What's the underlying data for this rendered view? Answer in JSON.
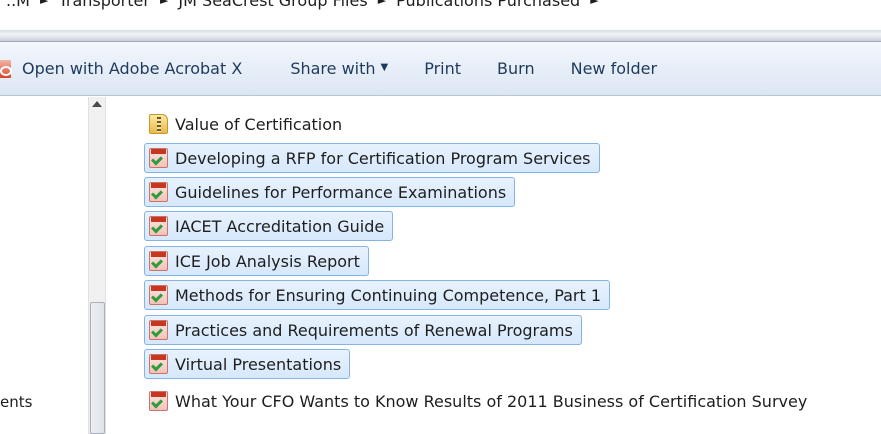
{
  "breadcrumb": {
    "items": [
      "..M",
      "Transporter",
      "JM SeaCrest Group Files",
      "Publications Purchased"
    ]
  },
  "toolbar": {
    "open_with": "Open with Adobe Acrobat X",
    "share_with": "Share with",
    "print": "Print",
    "burn": "Burn",
    "new_folder": "New folder"
  },
  "nav": {
    "partial_item": "ents"
  },
  "files": [
    {
      "name": "Value of Certification",
      "icon": "zip-folder-icon",
      "selected": false
    },
    {
      "name": "Developing a RFP for Certification Program Services",
      "icon": "pdf-icon",
      "selected": true
    },
    {
      "name": "Guidelines for Performance Examinations",
      "icon": "pdf-icon",
      "selected": true
    },
    {
      "name": "IACET Accreditation Guide",
      "icon": "pdf-icon",
      "selected": true
    },
    {
      "name": "ICE Job Analysis Report",
      "icon": "pdf-icon",
      "selected": true
    },
    {
      "name": "Methods for Ensuring Continuing Competence, Part 1",
      "icon": "pdf-icon",
      "selected": true
    },
    {
      "name": "Practices and Requirements of Renewal Programs",
      "icon": "pdf-icon",
      "selected": true
    },
    {
      "name": "Virtual Presentations",
      "icon": "pdf-icon",
      "selected": true
    },
    {
      "name": "What Your CFO Wants to Know Results of 2011 Business of Certification Survey",
      "icon": "pdf-icon",
      "selected": false
    }
  ],
  "colors": {
    "selection_fill": "#dcebfc",
    "selection_border": "#85b3e6",
    "toolbar_text": "#1e3a5c"
  }
}
